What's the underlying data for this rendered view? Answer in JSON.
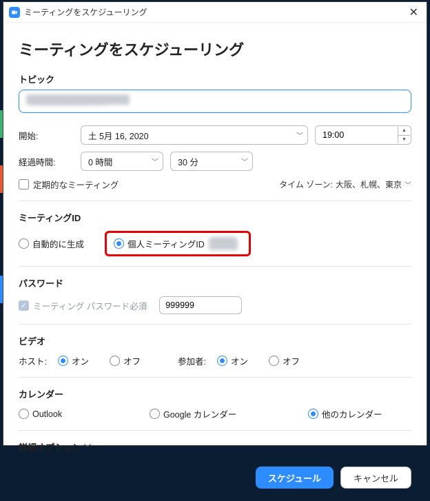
{
  "titlebar": {
    "title": "ミーティングをスケジューリング"
  },
  "heading": "ミーティングをスケジューリング",
  "topic": {
    "label": "トピック",
    "value": "████████████"
  },
  "start": {
    "label": "開始:",
    "date": "土 5月 16, 2020",
    "time": "19:00"
  },
  "duration": {
    "label": "経過時間:",
    "hours": "0 時間",
    "minutes": "30 分"
  },
  "recurring": {
    "label": "定期的なミーティング"
  },
  "timezone": {
    "label": "タイム ゾーン:",
    "value": "大阪、札幌、東京"
  },
  "meetingId": {
    "label": "ミーティングID",
    "auto": "自動的に生成",
    "personal": "個人ミーティングID",
    "personalId": "███"
  },
  "password": {
    "label": "パスワード",
    "require": "ミーティング パスワード必須",
    "value": "999999"
  },
  "video": {
    "label": "ビデオ",
    "host": "ホスト:",
    "participant": "参加者:",
    "on": "オン",
    "off": "オフ"
  },
  "calendar": {
    "label": "カレンダー",
    "outlook": "Outlook",
    "google": "Google カレンダー",
    "other": "他のカレンダー"
  },
  "advanced": "詳細オプション",
  "buttons": {
    "schedule": "スケジュール",
    "cancel": "キャンセル"
  }
}
